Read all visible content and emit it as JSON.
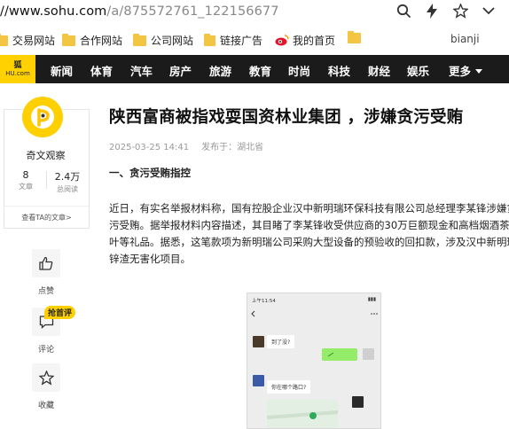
{
  "browser": {
    "url_prefix": "//www.sohu.com",
    "url_path": "/a/875572761_122156677",
    "icons": [
      "search-icon",
      "lightning-icon",
      "star-icon",
      "chevron-down-icon"
    ]
  },
  "bookmarks": {
    "items": [
      "交易网站",
      "合作网站",
      "公司网站",
      "链接广告",
      "我的首页"
    ],
    "right_text": "bianji",
    "folder_color": "#f4c542"
  },
  "nav": {
    "logo_top": "狐",
    "logo_bottom": "HU.com",
    "items": [
      "新闻",
      "体育",
      "汽车",
      "房产",
      "旅游",
      "教育",
      "时尚",
      "科技",
      "财经",
      "娱乐"
    ],
    "more": "更多",
    "accent": "#ffd100"
  },
  "author": {
    "name": "奇文观察",
    "articles_count": "8",
    "articles_label": "文章",
    "reads_count": "2.4万",
    "reads_label": "总阅读",
    "see_all": "查看TA的文章>"
  },
  "actions": {
    "like": "点赞",
    "comment": "评论",
    "comment_badge": "抢首评",
    "favorite": "收藏"
  },
  "article": {
    "title": "陕西富商被指戏耍国资林业集团 ，涉嫌贪污受贿",
    "date": "2025-03-25 14:41",
    "location": "发布于：湖北省",
    "section_heading": "一、贪污受贿指控",
    "paragraph_lines": [
      "近日，有实名举报材料称，国有控股企业汉中新明瑞环保科技有限公司总经理李某锋涉嫌贪",
      "污受贿。据举报材料内容描述，其目睹了李某锋收受供应商的30万巨额现金和高档烟酒茶",
      "叶等礼品。据悉，这笔款项为新明瑞公司采购大型设备的预验收的回扣款，涉及汉中新明瑞",
      "锌渣无害化项目。"
    ]
  },
  "chat_image": {
    "status_time": "上午11:54",
    "msg1": "到了没?",
    "msg2": "你在哪个路口?"
  }
}
